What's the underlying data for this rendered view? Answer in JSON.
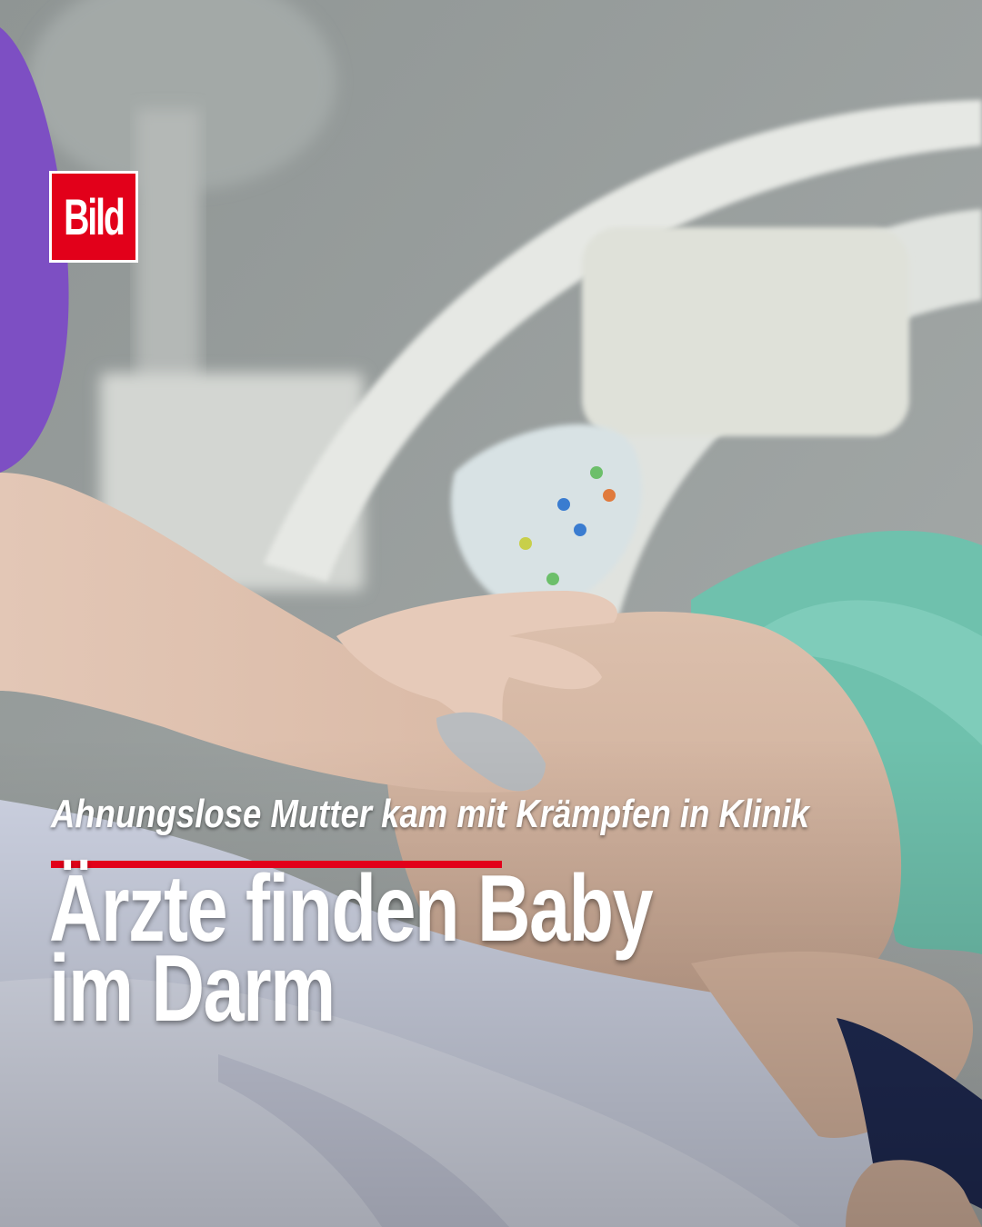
{
  "brand": {
    "logo_text": "Bild",
    "accent_color": "#e2001a"
  },
  "article": {
    "kicker": "Ahnungslose Mutter kam mit Krämpfen in Klinik",
    "headline_line1": "Ärzte finden Baby",
    "headline_line2": "im Darm"
  },
  "photo": {
    "subject": "hospital-bed-pregnancy-exam"
  }
}
